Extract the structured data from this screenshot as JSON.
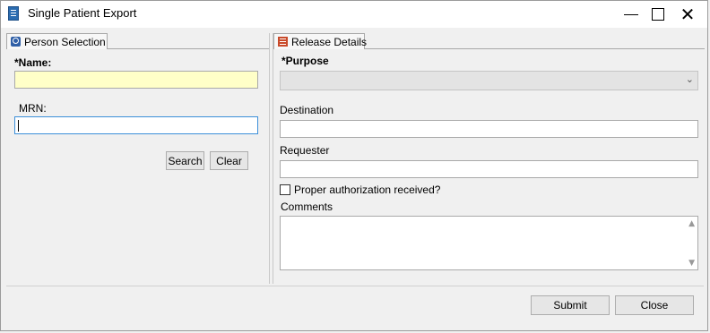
{
  "window": {
    "title": "Single Patient Export",
    "minimize_icon": "minimize-icon",
    "maximize_icon": "maximize-icon",
    "close_icon": "close-icon",
    "close_glyph": "✕"
  },
  "person_selection": {
    "tab_label": "Person Selection",
    "tab_icon": "magnifier-icon",
    "name_label": "*Name:",
    "name_value": "",
    "mrn_label": "MRN:",
    "mrn_value": "",
    "search_label": "Search",
    "clear_label": "Clear"
  },
  "release_details": {
    "tab_label": "Release Details",
    "tab_icon": "list-icon",
    "purpose_label": "*Purpose",
    "purpose_value": "",
    "destination_label": "Destination",
    "destination_value": "",
    "requester_label": "Requester",
    "requester_value": "",
    "authorization_label": "Proper authorization received?",
    "authorization_checked": false,
    "comments_label": "Comments",
    "comments_value": ""
  },
  "footer": {
    "submit_label": "Submit",
    "close_label": "Close"
  },
  "colors": {
    "required_field_bg": "#ffffc8",
    "focus_border": "#3c8fd9"
  }
}
